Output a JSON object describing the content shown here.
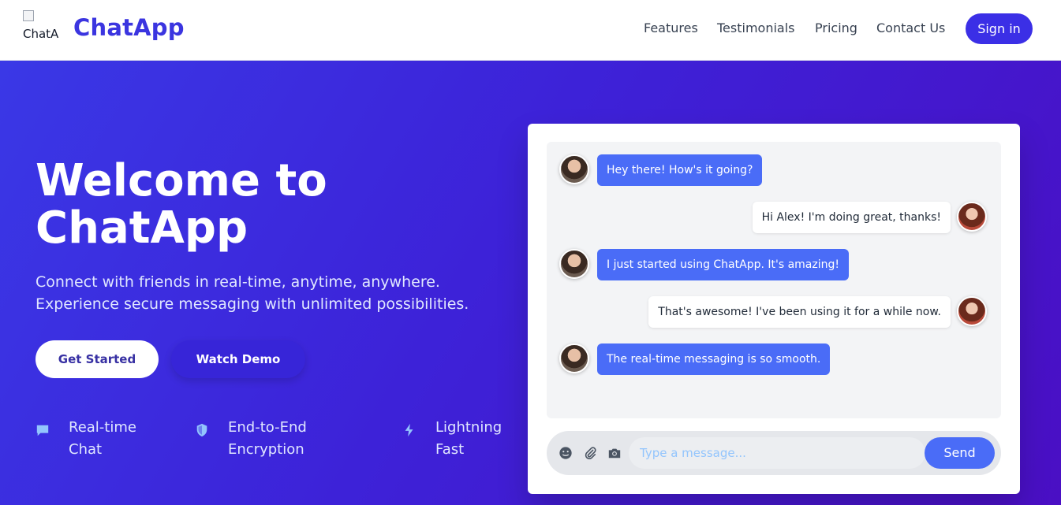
{
  "header": {
    "logo_alt": "ChatA",
    "brand": "ChatApp",
    "nav": [
      "Features",
      "Testimonials",
      "Pricing",
      "Contact Us"
    ],
    "signin_label": "Sign in"
  },
  "hero": {
    "title": "Welcome to ChatApp",
    "subtitle": "Connect with friends in real-time, anytime, anywhere. Experience secure messaging with unlimited possibilities.",
    "primary_cta": "Get Started",
    "secondary_cta": "Watch Demo",
    "features": [
      {
        "icon": "chat-bubble-icon",
        "label": "Real-time Chat"
      },
      {
        "icon": "shield-icon",
        "label": "End-to-End Encryption"
      },
      {
        "icon": "lightning-icon",
        "label": "Lightning Fast"
      }
    ]
  },
  "chat": {
    "messages": [
      {
        "side": "in",
        "text": "Hey there! How's it going?"
      },
      {
        "side": "out",
        "text": "Hi Alex! I'm doing great, thanks!"
      },
      {
        "side": "in",
        "text": "I just started using ChatApp. It's amazing!"
      },
      {
        "side": "out",
        "text": "That's awesome! I've been using it for a while now."
      },
      {
        "side": "in",
        "text": "The real-time messaging is so smooth."
      }
    ],
    "input_placeholder": "Type a message...",
    "send_label": "Send",
    "tools": [
      "smiley-icon",
      "paperclip-icon",
      "camera-icon"
    ]
  },
  "colors": {
    "brand": "#3b35e0",
    "incoming_bubble": "#4a6cf7",
    "hero_gradient_start": "#3a38e6",
    "hero_gradient_end": "#4a0fc4"
  }
}
